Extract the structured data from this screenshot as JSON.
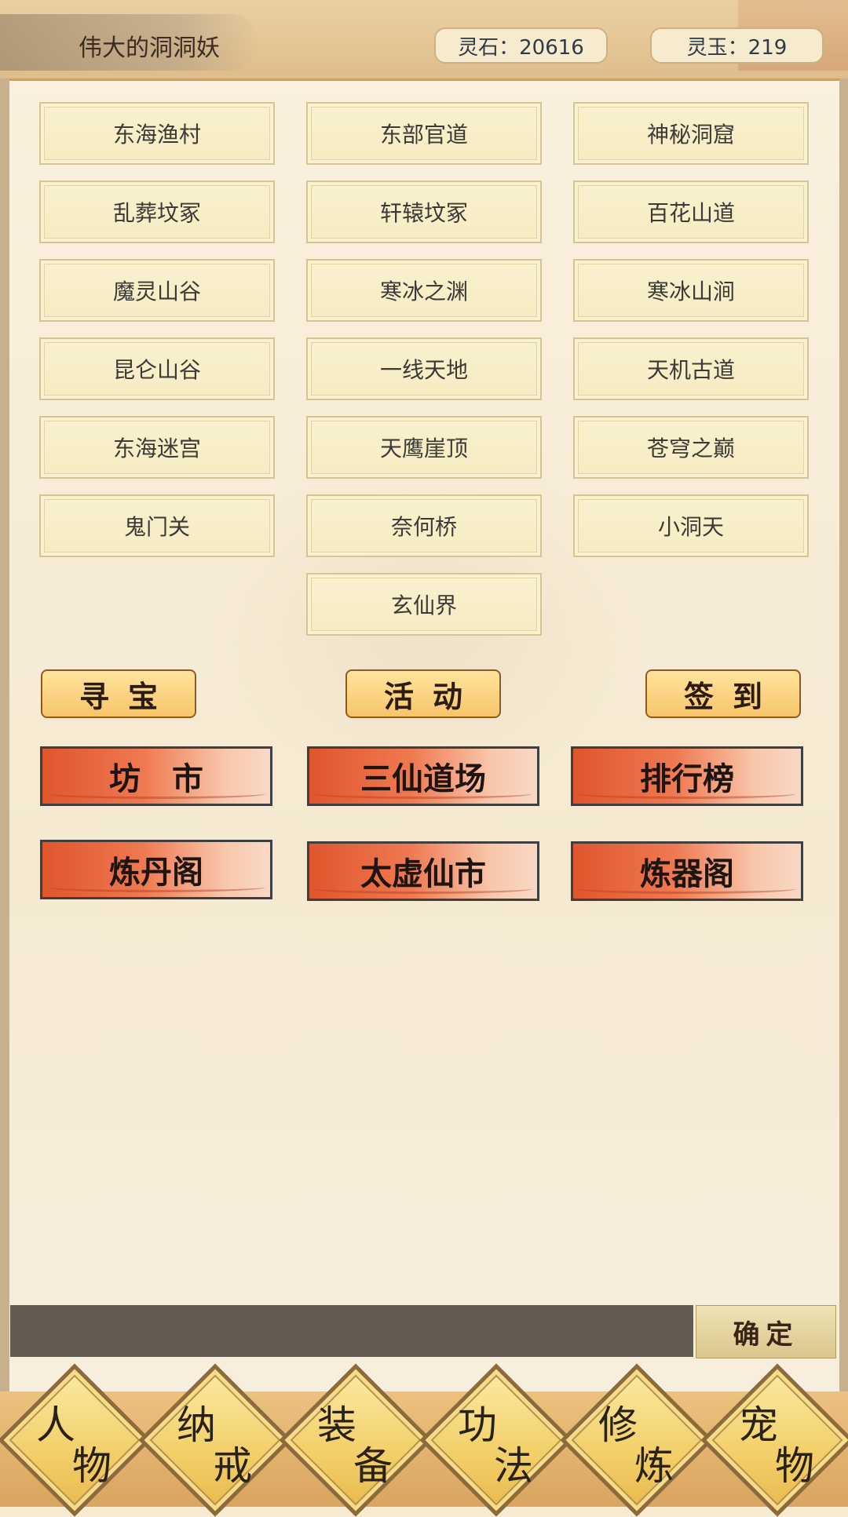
{
  "header": {
    "player_name": "伟大的洞洞妖",
    "spirit_stone": "灵石：20616",
    "spirit_jade": "灵玉：219"
  },
  "locations": [
    "东海渔村",
    "东部官道",
    "神秘洞窟",
    "乱葬坟冢",
    "轩辕坟冢",
    "百花山道",
    "魔灵山谷",
    "寒冰之渊",
    "寒冰山涧",
    "昆仑山谷",
    "一线天地",
    "天机古道",
    "东海迷宫",
    "天鹰崖顶",
    "苍穹之巅",
    "鬼门关",
    "奈何桥",
    "小洞天",
    "玄仙界"
  ],
  "actions": {
    "treasure": "寻宝",
    "activity": "活动",
    "checkin": "签到"
  },
  "facilities": {
    "market": "坊　市",
    "three_immortals": "三仙道场",
    "ranking": "排行榜",
    "alchemy": "炼丹阁",
    "taixu_market": "太虚仙市",
    "forge": "炼器阁"
  },
  "input": {
    "value": "",
    "confirm_label": "确定"
  },
  "nav": [
    {
      "c1": "人",
      "c2": "物"
    },
    {
      "c1": "纳",
      "c2": "戒"
    },
    {
      "c1": "装",
      "c2": "备"
    },
    {
      "c1": "功",
      "c2": "法"
    },
    {
      "c1": "修",
      "c2": "炼"
    },
    {
      "c1": "宠",
      "c2": "物"
    }
  ]
}
